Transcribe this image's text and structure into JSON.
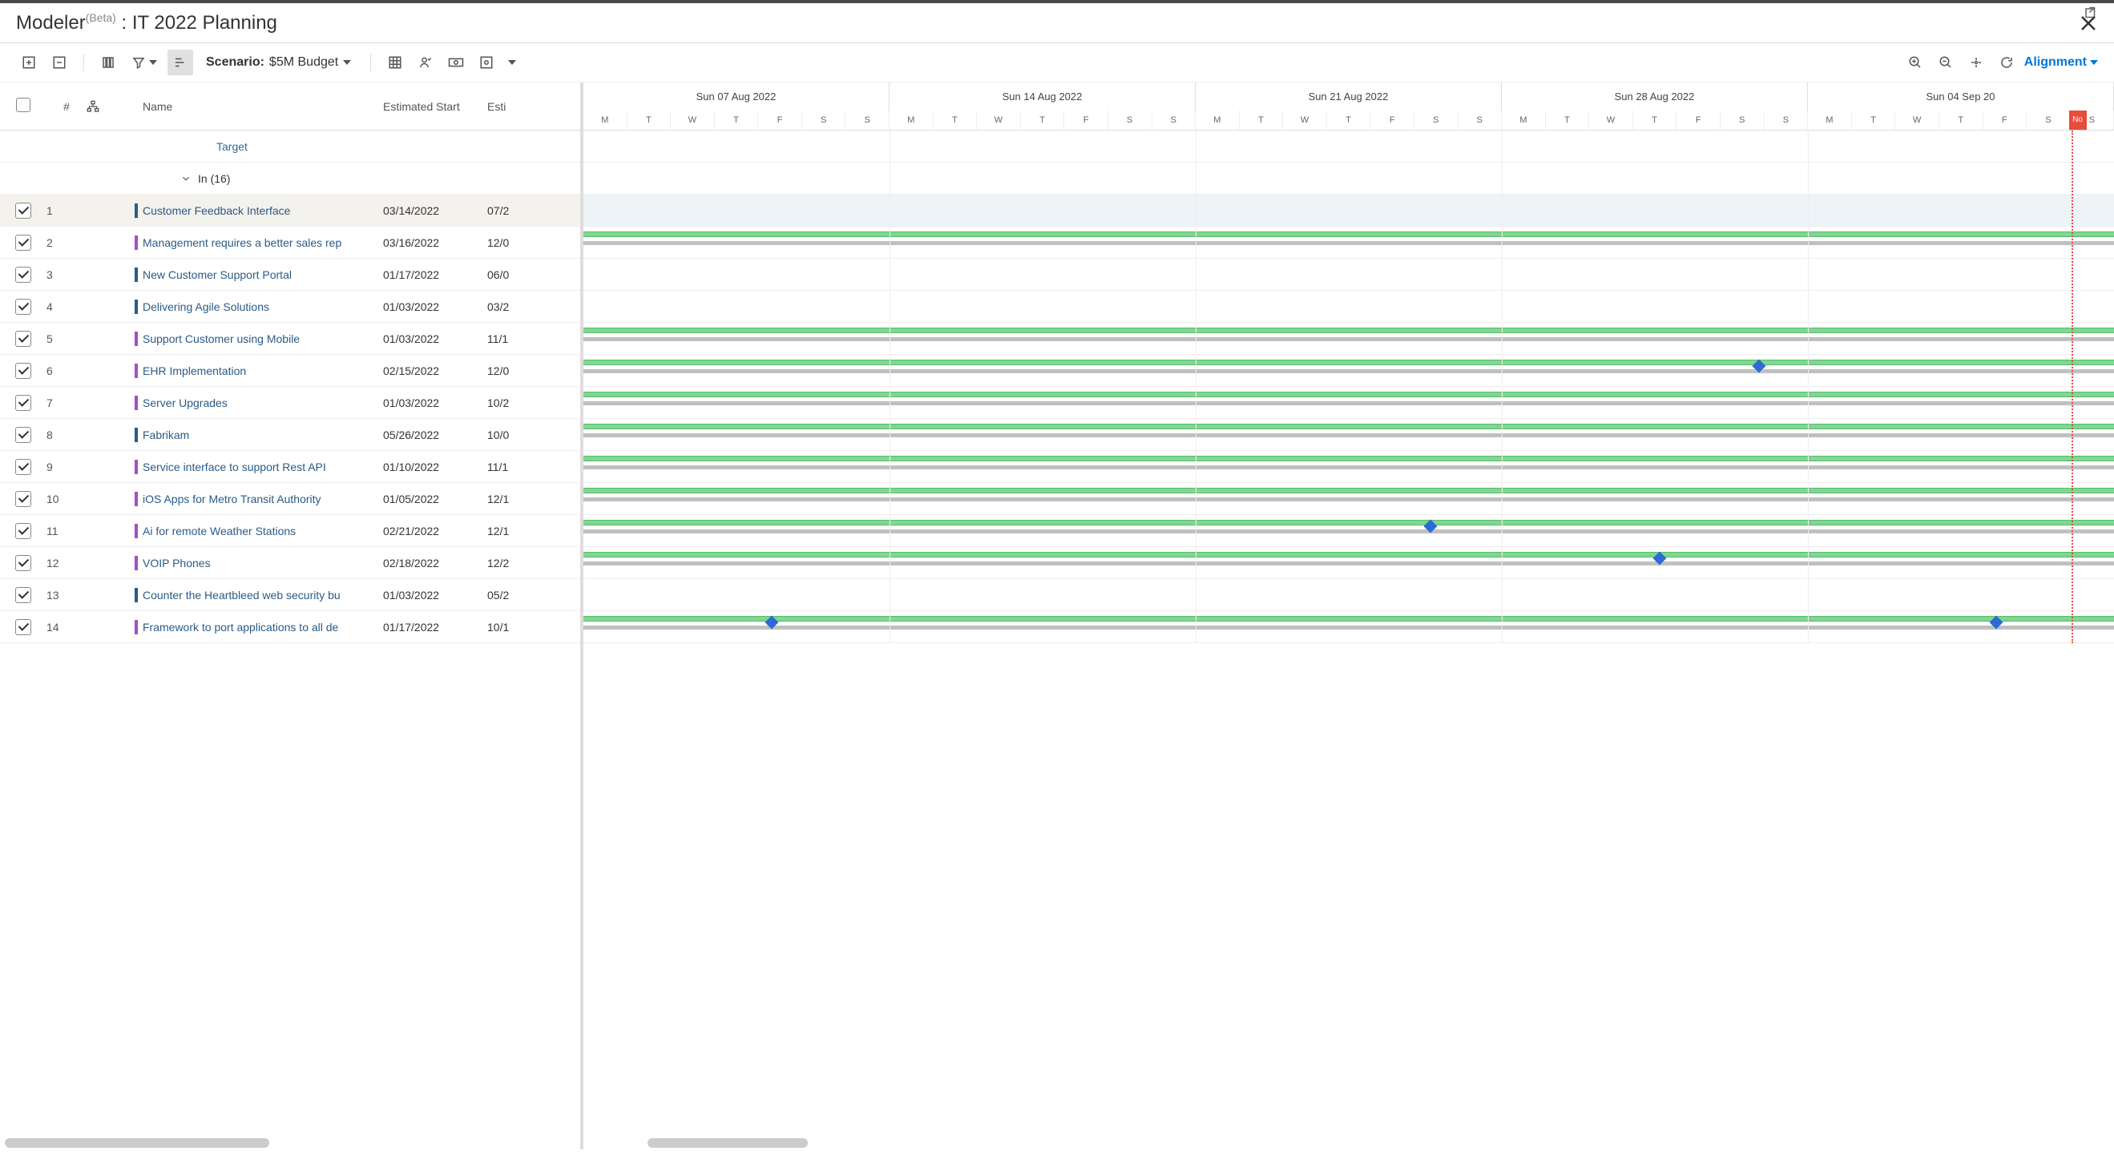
{
  "header": {
    "app": "Modeler",
    "beta": "(Beta)",
    "sep": " : ",
    "title": "IT 2022 Planning"
  },
  "toolbar": {
    "scenario_label": "Scenario:",
    "scenario_value": "$5M Budget",
    "alignment": "Alignment"
  },
  "columns": {
    "num": "#",
    "name": "Name",
    "est_start": "Estimated Start",
    "est_end": "Esti"
  },
  "target_label": "Target",
  "group": {
    "label": "In (16)"
  },
  "timeline": {
    "weeks": [
      "Sun 07 Aug 2022",
      "Sun 14 Aug 2022",
      "Sun 21 Aug 2022",
      "Sun 28 Aug 2022",
      "Sun 04 Sep 20"
    ],
    "days_pattern": [
      "M",
      "T",
      "W",
      "T",
      "F",
      "S",
      "S"
    ],
    "now_label": "No",
    "now_percent": 97.2
  },
  "rows": [
    {
      "n": 1,
      "name": "Customer Feedback Interface",
      "start": "03/14/2022",
      "end": "07/2",
      "color": "#2b5a87",
      "selected": true,
      "bar": false
    },
    {
      "n": 2,
      "name": "Management requires a better sales rep",
      "start": "03/16/2022",
      "end": "12/0",
      "color": "#a050c8",
      "bar": true
    },
    {
      "n": 3,
      "name": "New Customer Support Portal",
      "start": "01/17/2022",
      "end": "06/0",
      "color": "#2b5a87",
      "bar": false
    },
    {
      "n": 4,
      "name": "Delivering Agile Solutions",
      "start": "01/03/2022",
      "end": "03/2",
      "color": "#2b5a87",
      "bar": false
    },
    {
      "n": 5,
      "name": "Support Customer using Mobile",
      "start": "01/03/2022",
      "end": "11/1",
      "color": "#a050c8",
      "bar": true
    },
    {
      "n": 6,
      "name": "EHR Implementation",
      "start": "02/15/2022",
      "end": "12/0",
      "color": "#a050c8",
      "bar": true,
      "diamond": 76.5
    },
    {
      "n": 7,
      "name": "Server Upgrades",
      "start": "01/03/2022",
      "end": "10/2",
      "color": "#a050c8",
      "bar": true
    },
    {
      "n": 8,
      "name": "Fabrikam",
      "start": "05/26/2022",
      "end": "10/0",
      "color": "#2b5a87",
      "bar": true
    },
    {
      "n": 9,
      "name": "Service interface to support Rest API",
      "start": "01/10/2022",
      "end": "11/1",
      "color": "#a050c8",
      "bar": true
    },
    {
      "n": 10,
      "name": "iOS Apps for Metro Transit Authority",
      "start": "01/05/2022",
      "end": "12/1",
      "color": "#a050c8",
      "bar": true
    },
    {
      "n": 11,
      "name": "Ai for remote Weather Stations",
      "start": "02/21/2022",
      "end": "12/1",
      "color": "#a050c8",
      "bar": true,
      "diamond": 55
    },
    {
      "n": 12,
      "name": "VOIP Phones",
      "start": "02/18/2022",
      "end": "12/2",
      "color": "#a050c8",
      "bar": true,
      "diamond": 70
    },
    {
      "n": 13,
      "name": "Counter the Heartbleed web security bu",
      "start": "01/03/2022",
      "end": "05/2",
      "color": "#2b5a87",
      "bar": false
    },
    {
      "n": 14,
      "name": "Framework to port applications to all de",
      "start": "01/17/2022",
      "end": "10/1",
      "color": "#a050c8",
      "bar": true,
      "diamond": 12,
      "diamond2": 92
    }
  ]
}
